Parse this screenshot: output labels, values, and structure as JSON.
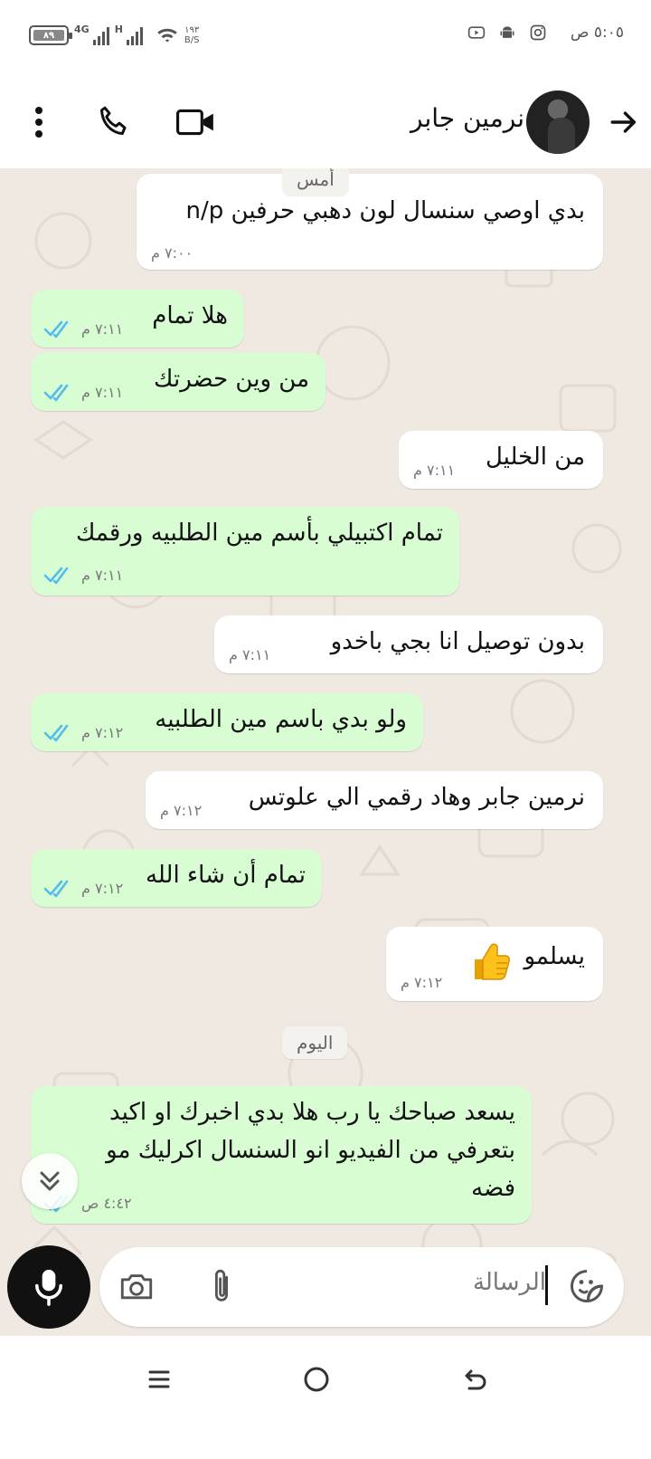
{
  "status_bar": {
    "time": "٥:٠٥ ص",
    "battery": "٨٩",
    "network_1": "4G",
    "network_2": "H",
    "speed_value": "١٩٣",
    "speed_unit": "B/S"
  },
  "header": {
    "contact_name": "نرمين جابر",
    "icons": [
      "back-arrow-icon",
      "avatar",
      "video-call-icon",
      "phone-icon",
      "more-vert-icon"
    ]
  },
  "chat": {
    "date_yesterday": "أمس",
    "date_today": "اليوم",
    "messages": [
      {
        "dir": "in",
        "text": "بدي اوصي سنسال لون دهبي حرفين n/p",
        "time": "٧:٠٠ م"
      },
      {
        "dir": "out",
        "text": "هلا تمام",
        "time": "٧:١١ م"
      },
      {
        "dir": "out",
        "text": "من وين حضرتك",
        "time": "٧:١١ م"
      },
      {
        "dir": "in",
        "text": "من الخليل",
        "time": "٧:١١ م"
      },
      {
        "dir": "out",
        "text": "تمام اكتبيلي بأسم مين الطلبيه ورقمك",
        "time": "٧:١١ م"
      },
      {
        "dir": "in",
        "text": "بدون توصيل انا بجي باخدو",
        "time": "٧:١١ م"
      },
      {
        "dir": "out",
        "text": "ولو بدي باسم مين الطلبيه",
        "time": "٧:١٢ م"
      },
      {
        "dir": "in",
        "text": "نرمين جابر وهاد رقمي الي علوتس",
        "time": "٧:١٢ م"
      },
      {
        "dir": "out",
        "text": "تمام أن شاء الله",
        "time": "٧:١٢ م"
      },
      {
        "dir": "in",
        "text": "يسلمو",
        "time": "٧:١٢ م"
      },
      {
        "dir": "out",
        "text_lines": [
          "يسعد صباحك يا رب هلا بدي اخبرك او اكيد",
          "بتعرفي من الفيديو انو السنسال اكرليك مو",
          "فضه"
        ],
        "time": "٤:٤٢ ص"
      }
    ]
  },
  "composer": {
    "placeholder": "الرسالة"
  },
  "colors": {
    "outgoing_bubble": "#d9fdd3",
    "incoming_bubble": "#ffffff",
    "wallpaper": "#efe9e1",
    "read_ticks": "#53bdeb"
  }
}
